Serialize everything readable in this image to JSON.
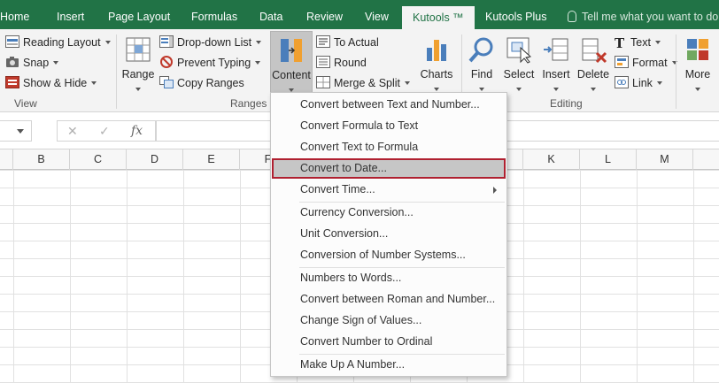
{
  "tabs": [
    {
      "label": "Home"
    },
    {
      "label": "Insert"
    },
    {
      "label": "Page Layout"
    },
    {
      "label": "Formulas"
    },
    {
      "label": "Data"
    },
    {
      "label": "Review"
    },
    {
      "label": "View"
    },
    {
      "label": "Kutools ™"
    },
    {
      "label": "Kutools Plus"
    }
  ],
  "tell_me": "Tell me what you want to do...",
  "ribbon": {
    "view_group": {
      "reading_layout": "Reading Layout",
      "snap": "Snap",
      "show_hide": "Show & Hide",
      "label": "View"
    },
    "range": "Range",
    "ranges_group": {
      "dropdown_list": "Drop-down List",
      "prevent_typing": "Prevent Typing",
      "copy_ranges": "Copy Ranges",
      "label": "Ranges &"
    },
    "content": "Content",
    "to_actual": "To Actual",
    "round": "Round",
    "merge_split": "Merge & Split",
    "charts": "Charts",
    "find": "Find",
    "select": "Select",
    "insert": "Insert",
    "delete": "Delete",
    "text": "Text",
    "format": "Format",
    "link": "Link",
    "more": "More",
    "editing_label": "Editing"
  },
  "formula_bar": {
    "fx": "fx"
  },
  "columns": [
    "B",
    "C",
    "D",
    "E",
    "F",
    "K",
    "L",
    "M"
  ],
  "menu": {
    "items": [
      {
        "label": "Convert between Text and Number..."
      },
      {
        "label": "Convert Formula to Text"
      },
      {
        "label": "Convert Text to Formula"
      },
      {
        "label": "Convert to Date..."
      },
      {
        "label": "Convert Time..."
      },
      {
        "label": "Currency Conversion..."
      },
      {
        "label": "Unit Conversion..."
      },
      {
        "label": "Conversion of Number Systems..."
      },
      {
        "label": "Numbers to Words..."
      },
      {
        "label": "Convert between Roman and Number..."
      },
      {
        "label": "Change Sign of Values..."
      },
      {
        "label": "Convert Number to Ordinal"
      },
      {
        "label": "Make Up A Number..."
      }
    ]
  },
  "colors": {
    "accent": "#217346",
    "highlight_border": "#b02030"
  }
}
